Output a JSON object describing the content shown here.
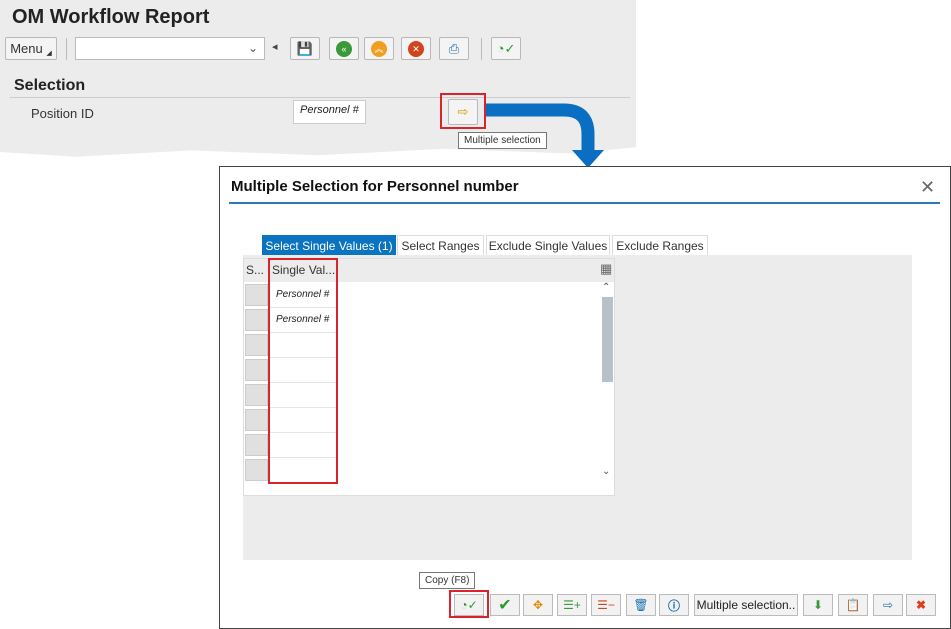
{
  "report": {
    "title": "OM Workflow Report",
    "menu_label": "Menu",
    "command_field_value": "",
    "section_title": "Selection",
    "field_label": "Position ID",
    "field_value": "Personnel #",
    "tooltip": "Multiple selection",
    "toolbar_icons": [
      "save-icon",
      "back-icon",
      "exit-icon",
      "cancel-icon",
      "print-icon",
      "execute-icon"
    ]
  },
  "dialog": {
    "title": "Multiple Selection for Personnel number",
    "close_label": "✕",
    "tabs": [
      {
        "label": "Select Single Values (1)",
        "active": true
      },
      {
        "label": "Select Ranges"
      },
      {
        "label": "Exclude Single Values"
      },
      {
        "label": "Exclude Ranges"
      }
    ],
    "columns": [
      "S...",
      "Single Val..."
    ],
    "rows": [
      "Personnel #",
      "Personnel #",
      "",
      "",
      "",
      "",
      "",
      ""
    ],
    "copy_tooltip": "Copy (F8)",
    "multiple_selection_label": "Multiple selection..",
    "accent": "#0a74c0"
  }
}
